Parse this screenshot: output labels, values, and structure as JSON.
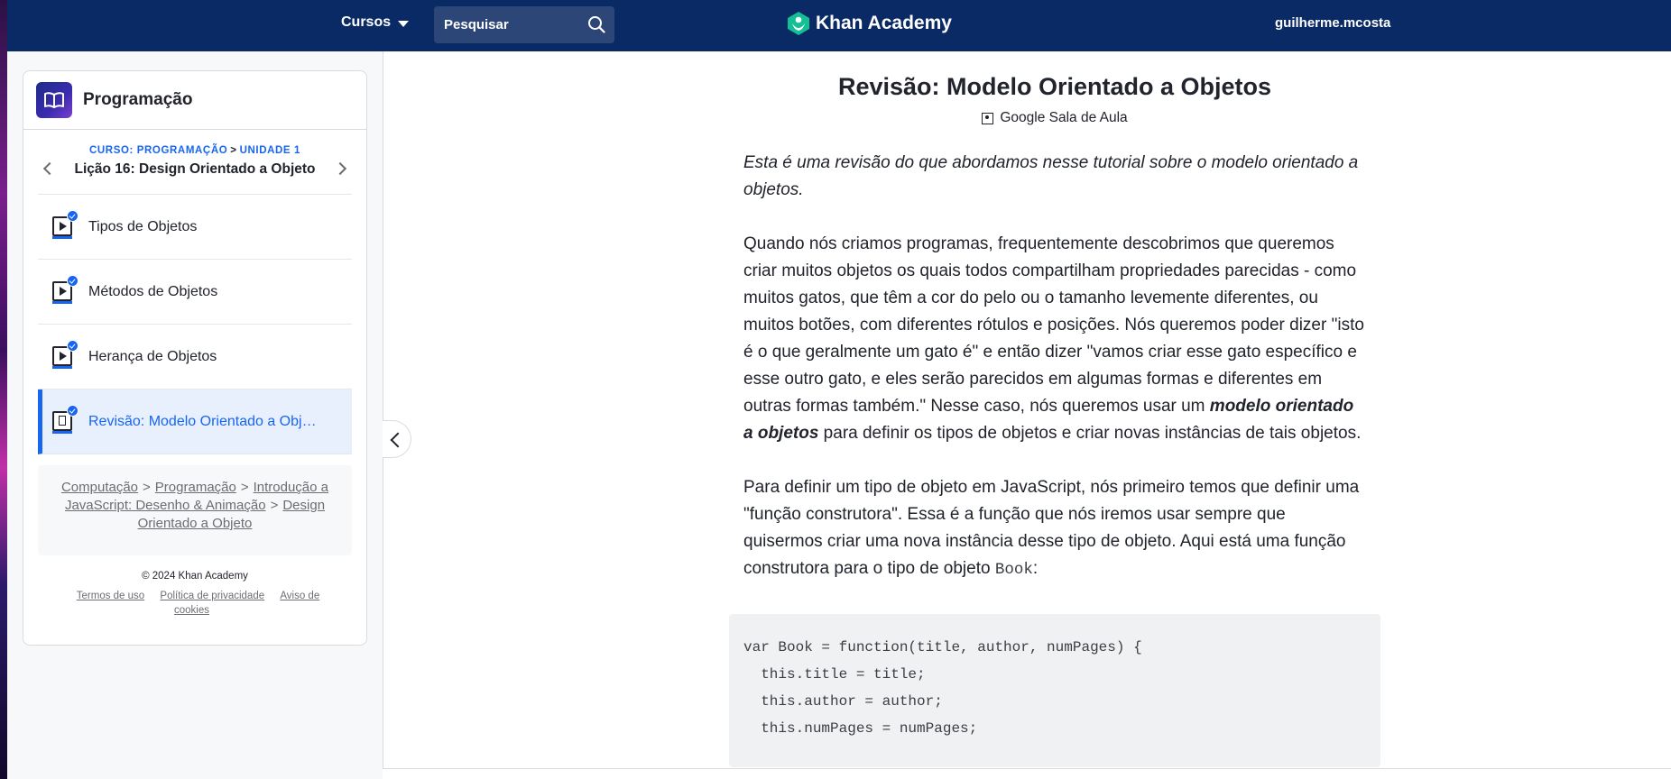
{
  "nav": {
    "courses_label": "Cursos",
    "search_placeholder": "Pesquisar",
    "brand": "Khan Academy",
    "username": "guilherme.mcosta"
  },
  "sidebar": {
    "subject_title": "Programação",
    "course_crumb": "CURSO: PROGRAMAÇÃO",
    "crumb_sep": ">",
    "unit_crumb": "UNIDADE 1",
    "lesson_title": "Lição 16: Design Orientado a Objeto",
    "items": [
      {
        "label": "Tipos de Objetos",
        "type": "video",
        "completed": true,
        "active": false
      },
      {
        "label": "Métodos de Objetos",
        "type": "video",
        "completed": true,
        "active": false
      },
      {
        "label": "Herança de Objetos",
        "type": "video",
        "completed": true,
        "active": false
      },
      {
        "label": "Revisão: Modelo Orientado a Objetos",
        "type": "article",
        "completed": true,
        "active": true
      }
    ],
    "breadcrumb": [
      "Computação",
      "Programação",
      "Introdução a JavaScript: Desenho & Animação",
      "Design Orientado a Objeto"
    ],
    "breadcrumb_sep": ">",
    "copyright": "© 2024 Khan Academy",
    "footer_links": [
      "Termos de uso",
      "Política de privacidade",
      "Aviso de cookies"
    ]
  },
  "article": {
    "title": "Revisão: Modelo Orientado a Objetos",
    "classroom_label": "Google Sala de Aula",
    "intro": "Esta é uma revisão do que abordamos nesse tutorial sobre o modelo orientado a objetos.",
    "p1_before": "Quando nós criamos programas, frequentemente descobrimos que queremos criar muitos objetos os quais todos compartilham propriedades parecidas - como muitos gatos, que têm a cor do pelo ou o tamanho levemente diferentes, ou muitos botões, com diferentes rótulos e posições. Nós queremos poder dizer \"isto é o que geralmente um gato é\" e então dizer \"vamos criar esse gato específico e esse outro gato, e eles serão parecidos em algumas formas e diferentes em outras formas também.\" Nesse caso, nós queremos usar um ",
    "p1_emphasis": "modelo orientado a objetos",
    "p1_after": " para definir os tipos de objetos e criar novas instâncias de tais objetos.",
    "p2_before": "Para definir um tipo de objeto em JavaScript, nós primeiro temos que definir uma \"função construtora\". Essa é a função que nós iremos usar sempre que quisermos criar uma nova instância desse tipo de objeto. Aqui está uma função construtora para o tipo de objeto ",
    "p2_code": "Book",
    "p2_after": ":",
    "code_lines": [
      "var Book = function(title, author, numPages) {",
      "  this.title = title;",
      "  this.author = author;",
      "  this.numPages = numPages;"
    ]
  },
  "colors": {
    "nav_bg": "#0a2a66",
    "accent": "#1865f2",
    "brand_green": "#14bf96"
  },
  "icons": {
    "search": "search-icon",
    "logo": "khan-academy-logo-icon",
    "subject": "book-icon",
    "video": "video-icon",
    "article": "article-icon",
    "classroom": "google-classroom-icon"
  }
}
